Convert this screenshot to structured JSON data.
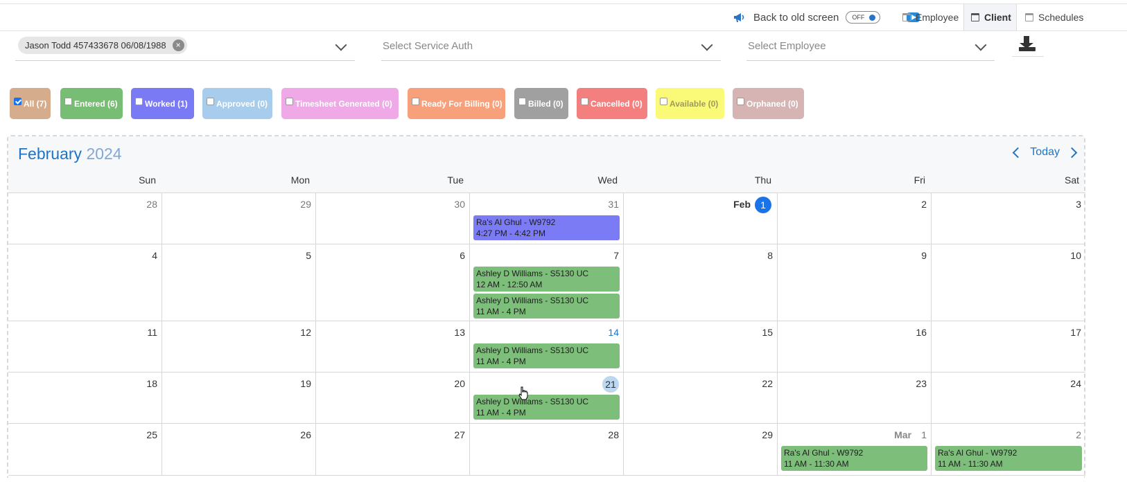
{
  "topbar": {
    "back_label": "Back to old screen",
    "toggle_label": "OFF",
    "tabs": [
      "Employee",
      "Client",
      "Schedules"
    ]
  },
  "selects": {
    "client_chip": "Jason Todd 457433678 06/08/1988",
    "service_auth_placeholder": "Select Service Auth",
    "employee_placeholder": "Select Employee"
  },
  "filters": [
    {
      "label": "All (7)",
      "color": "#d6ad8c",
      "checked": true
    },
    {
      "label": "Entered (6)",
      "color": "#77bd74"
    },
    {
      "label": "Worked (1)",
      "color": "#7a7af5"
    },
    {
      "label": "Approved (0)",
      "color": "#a8ccec"
    },
    {
      "label": "Timesheet Generated (0)",
      "color": "#efa9e6"
    },
    {
      "label": "Ready For Billing (0)",
      "color": "#f7a07c"
    },
    {
      "label": "Billed (0)",
      "color": "#a0a0a0"
    },
    {
      "label": "Cancelled (0)",
      "color": "#f37f7f"
    },
    {
      "label": "Available (0)",
      "color": "#fafa78"
    },
    {
      "label": "Orphaned (0)",
      "color": "#d7b4b4"
    }
  ],
  "calendar": {
    "month": "February",
    "year": "2024",
    "today_label": "Today",
    "days_of_week": [
      "Sun",
      "Mon",
      "Tue",
      "Wed",
      "Thu",
      "Fri",
      "Sat"
    ],
    "weeks": [
      {
        "days": [
          "28",
          "29",
          "30",
          "31",
          "1",
          "2",
          "3"
        ]
      },
      {
        "days": [
          "4",
          "5",
          "6",
          "7",
          "8",
          "9",
          "10"
        ]
      },
      {
        "days": [
          "11",
          "12",
          "13",
          "14",
          "15",
          "16",
          "17"
        ]
      },
      {
        "days": [
          "18",
          "19",
          "20",
          "21",
          "22",
          "23",
          "24"
        ]
      },
      {
        "days": [
          "25",
          "26",
          "27",
          "28",
          "29",
          "1",
          "2"
        ]
      }
    ],
    "feb_label": "Feb",
    "mar_label": "Mar",
    "events": [
      {
        "title": "Ra's Al Ghul - W9792",
        "time": "4:27 PM - 4:42 PM"
      },
      {
        "title": "Ashley D Williams - S5130 UC",
        "time": "12 AM - 12:50 AM"
      },
      {
        "title": "Ashley D Williams - S5130 UC",
        "time": "11 AM - 4 PM"
      },
      {
        "title": "Ashley D Williams - S5130 UC",
        "time": "11 AM - 4 PM"
      },
      {
        "title": "Ashley D Williams - S5130 UC",
        "time": "11 AM - 4 PM"
      },
      {
        "title": "Ra's Al Ghul - W9792",
        "time": "11 AM - 11:30 AM"
      },
      {
        "title": "Ra's Al Ghul - W9792",
        "time": "11 AM - 11:30 AM"
      }
    ]
  }
}
